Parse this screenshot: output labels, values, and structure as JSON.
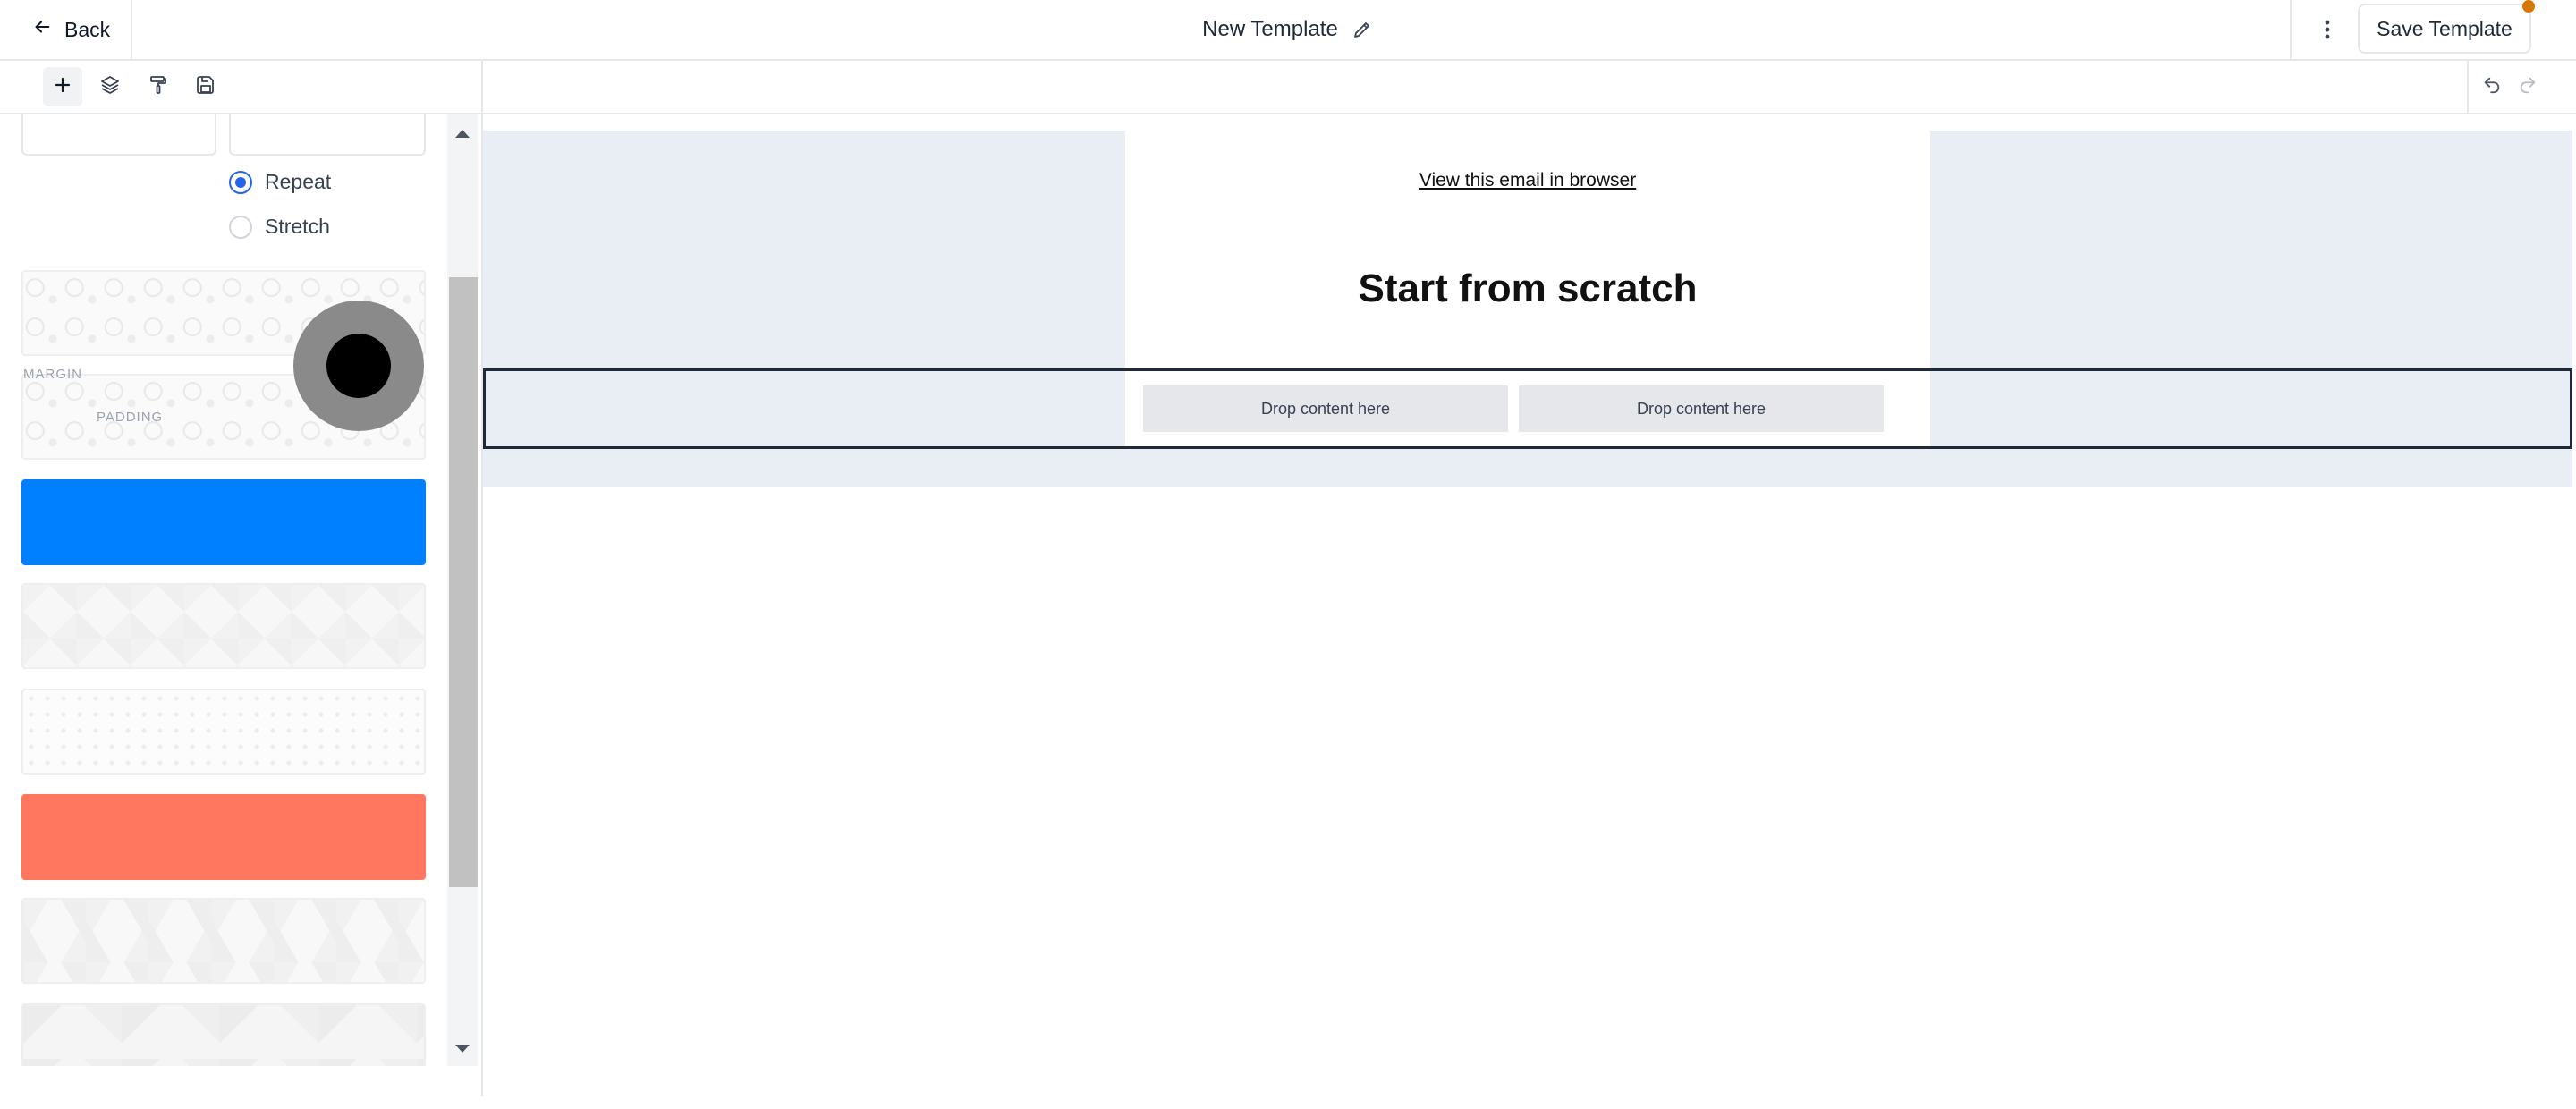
{
  "header": {
    "back_label": "Back",
    "template_title": "New Template",
    "save_label": "Save Template",
    "unsaved_indicator_color": "#d97706"
  },
  "toolbar": {
    "tools": [
      "add-icon",
      "layers-icon",
      "paint-roller-icon",
      "save-icon"
    ],
    "active_tool": "add-icon",
    "history": [
      "undo-icon",
      "redo-icon"
    ]
  },
  "panel": {
    "background_size_options": [
      {
        "label": "Repeat",
        "selected": true
      },
      {
        "label": "Stretch",
        "selected": false
      }
    ],
    "spacing_labels": {
      "margin": "MARGIN",
      "padding": "PADDING"
    },
    "swatch_colors": {
      "blue": "#0080ff",
      "coral": "#ff775f"
    },
    "picker_color": "#000000"
  },
  "canvas": {
    "view_in_browser_link": "View this email in browser",
    "heading": "Start from scratch",
    "drop_zones": [
      "Drop content here",
      "Drop content here"
    ],
    "background_color": "#e9eef5"
  }
}
